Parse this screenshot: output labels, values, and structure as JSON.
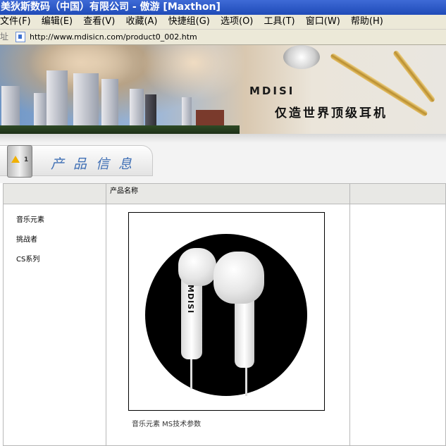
{
  "window": {
    "title": "美狄斯数码（中国）有限公司 - 傲游 [Maxthon]"
  },
  "menu": {
    "items": [
      "文件(F)",
      "编辑(E)",
      "查看(V)",
      "收藏(A)",
      "快捷组(G)",
      "选项(O)",
      "工具(T)",
      "窗口(W)",
      "帮助(H)"
    ]
  },
  "address": {
    "label": "址",
    "url": "http://www.mdisicn.com/product0_002.htm"
  },
  "banner": {
    "logo": "MDISI",
    "slogan": "仅造世界顶级耳机"
  },
  "section": {
    "title": "产品信息",
    "cabinet_number": "1"
  },
  "table": {
    "header_product_name": "产品名称",
    "categories": [
      "音乐元素",
      "挑战者",
      "CS系列"
    ],
    "photo_brand": "MDISI",
    "caption": "音乐元素 MS技术参数"
  }
}
